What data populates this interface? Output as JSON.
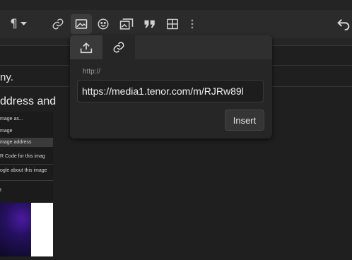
{
  "toolbar": {
    "paragraph_label": "¶",
    "icons": [
      "paragraph-icon",
      "link-icon",
      "image-icon",
      "emoji-icon",
      "gallery-icon",
      "quote-icon",
      "table-icon",
      "more-icon",
      "undo-icon"
    ]
  },
  "editor": {
    "line1": "ny.",
    "line2": "ddress and"
  },
  "context_menu": {
    "items": [
      "mage as...",
      "mage",
      "mage address",
      "R Code for this imag",
      "ogle about this image"
    ],
    "trailing": "t"
  },
  "image_dialog": {
    "tabs": [
      {
        "icon": "upload-icon"
      },
      {
        "icon": "link-icon"
      }
    ],
    "url_label": "http://",
    "url_value": "https://media1.tenor.com/m/RJRw89l",
    "insert_label": "Insert"
  }
}
